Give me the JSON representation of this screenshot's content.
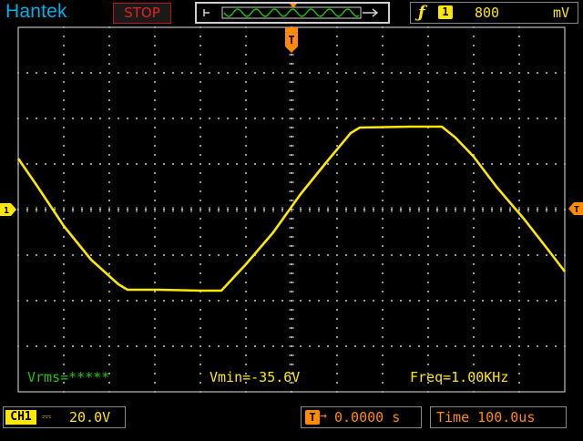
{
  "header": {
    "brand": "Hantek",
    "run_state": "STOP",
    "trigger": {
      "slope_icon": "rising-edge-icon",
      "source": "1",
      "level": "800",
      "unit": "mV"
    }
  },
  "screen": {
    "trigger_marker": "T",
    "channel_marker": "1",
    "measurements": {
      "vrms": "Vrms=*****",
      "vmin": "Vmin=-35.6V",
      "freq": "Freq=1.00KHz"
    }
  },
  "footer": {
    "channel": {
      "label": "CH1",
      "coupling": "⎓",
      "scale": "20.0V"
    },
    "position": {
      "icon": "T",
      "arrow": "→",
      "value": "0.0000 s"
    },
    "timebase": "Time 100.0us"
  },
  "colors": {
    "brand": "#00b0e8",
    "trace": "#ffe800",
    "stop": "#e82020",
    "marker": "#ff8c00",
    "measure_green": "#21c400"
  }
}
